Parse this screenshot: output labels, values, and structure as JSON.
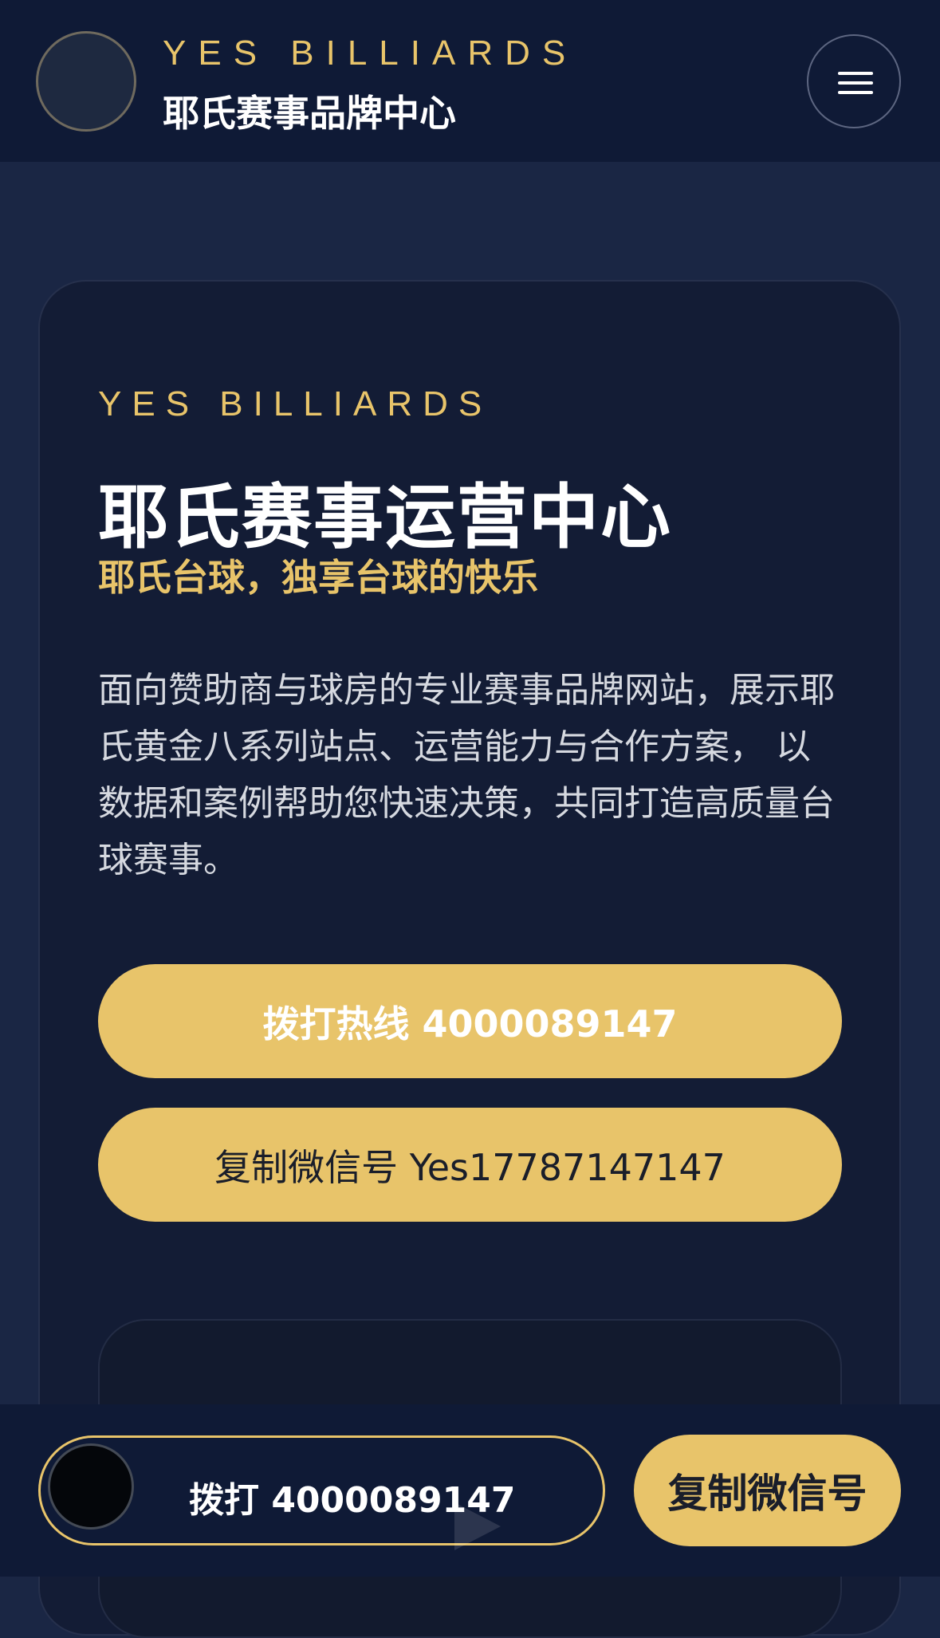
{
  "header": {
    "brand_en": "YES BILLIARDS",
    "brand_cn": "耶氏赛事品牌中心",
    "menu_icon": "hamburger-menu-icon"
  },
  "hero": {
    "kicker": "YES BILLIARDS",
    "title": "耶氏赛事运营中心",
    "subtitle": "耶氏台球，独享台球的快乐",
    "description": "面向赞助商与球房的专业赛事品牌网站，展示耶氏黄金八系列站点、运营能力与合作方案， 以数据和案例帮助您快速决策，共同打造高质量台球赛事。",
    "call_button": "拨打热线 4000089147",
    "wechat_button": "复制微信号 Yes17787147147"
  },
  "bottom_bar": {
    "call_label": "拨打 4000089147",
    "wechat_label": "复制微信号"
  },
  "colors": {
    "accent": "#e8c46a",
    "header_bg": "#0f1a36",
    "page_bg": "#1a2644",
    "card_bg": "#131c35"
  }
}
